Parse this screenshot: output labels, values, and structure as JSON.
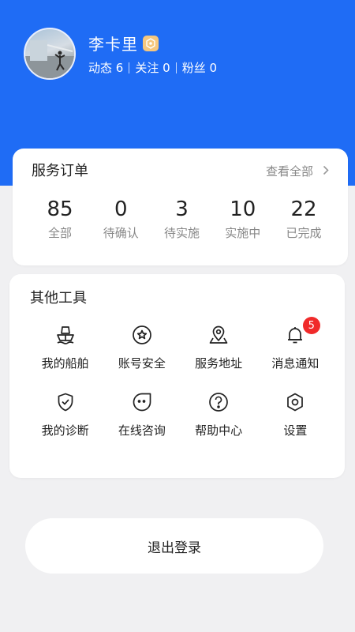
{
  "profile": {
    "name": "李卡里",
    "badge_icon": "vip-badge-icon",
    "stats": [
      {
        "label": "动态",
        "value": "6"
      },
      {
        "label": "关注",
        "value": "0"
      },
      {
        "label": "粉丝",
        "value": "0"
      }
    ]
  },
  "orders": {
    "title": "服务订单",
    "view_all": "查看全部",
    "items": [
      {
        "value": "85",
        "label": "全部"
      },
      {
        "value": "0",
        "label": "待确认"
      },
      {
        "value": "3",
        "label": "待实施"
      },
      {
        "value": "10",
        "label": "实施中"
      },
      {
        "value": "22",
        "label": "已完成"
      }
    ]
  },
  "tools": {
    "title": "其他工具",
    "items": [
      {
        "label": "我的船舶",
        "icon": "ship-icon"
      },
      {
        "label": "账号安全",
        "icon": "shield-star-icon"
      },
      {
        "label": "服务地址",
        "icon": "location-map-icon"
      },
      {
        "label": "消息通知",
        "icon": "bell-icon",
        "badge": "5"
      },
      {
        "label": "我的诊断",
        "icon": "shield-check-icon"
      },
      {
        "label": "在线咨询",
        "icon": "chat-face-icon"
      },
      {
        "label": "帮助中心",
        "icon": "help-icon"
      },
      {
        "label": "设置",
        "icon": "settings-hex-icon"
      }
    ]
  },
  "logout_label": "退出登录",
  "colors": {
    "header": "#1f6cf5",
    "badge": "#f02a2a",
    "vip": "#f6c77e"
  }
}
